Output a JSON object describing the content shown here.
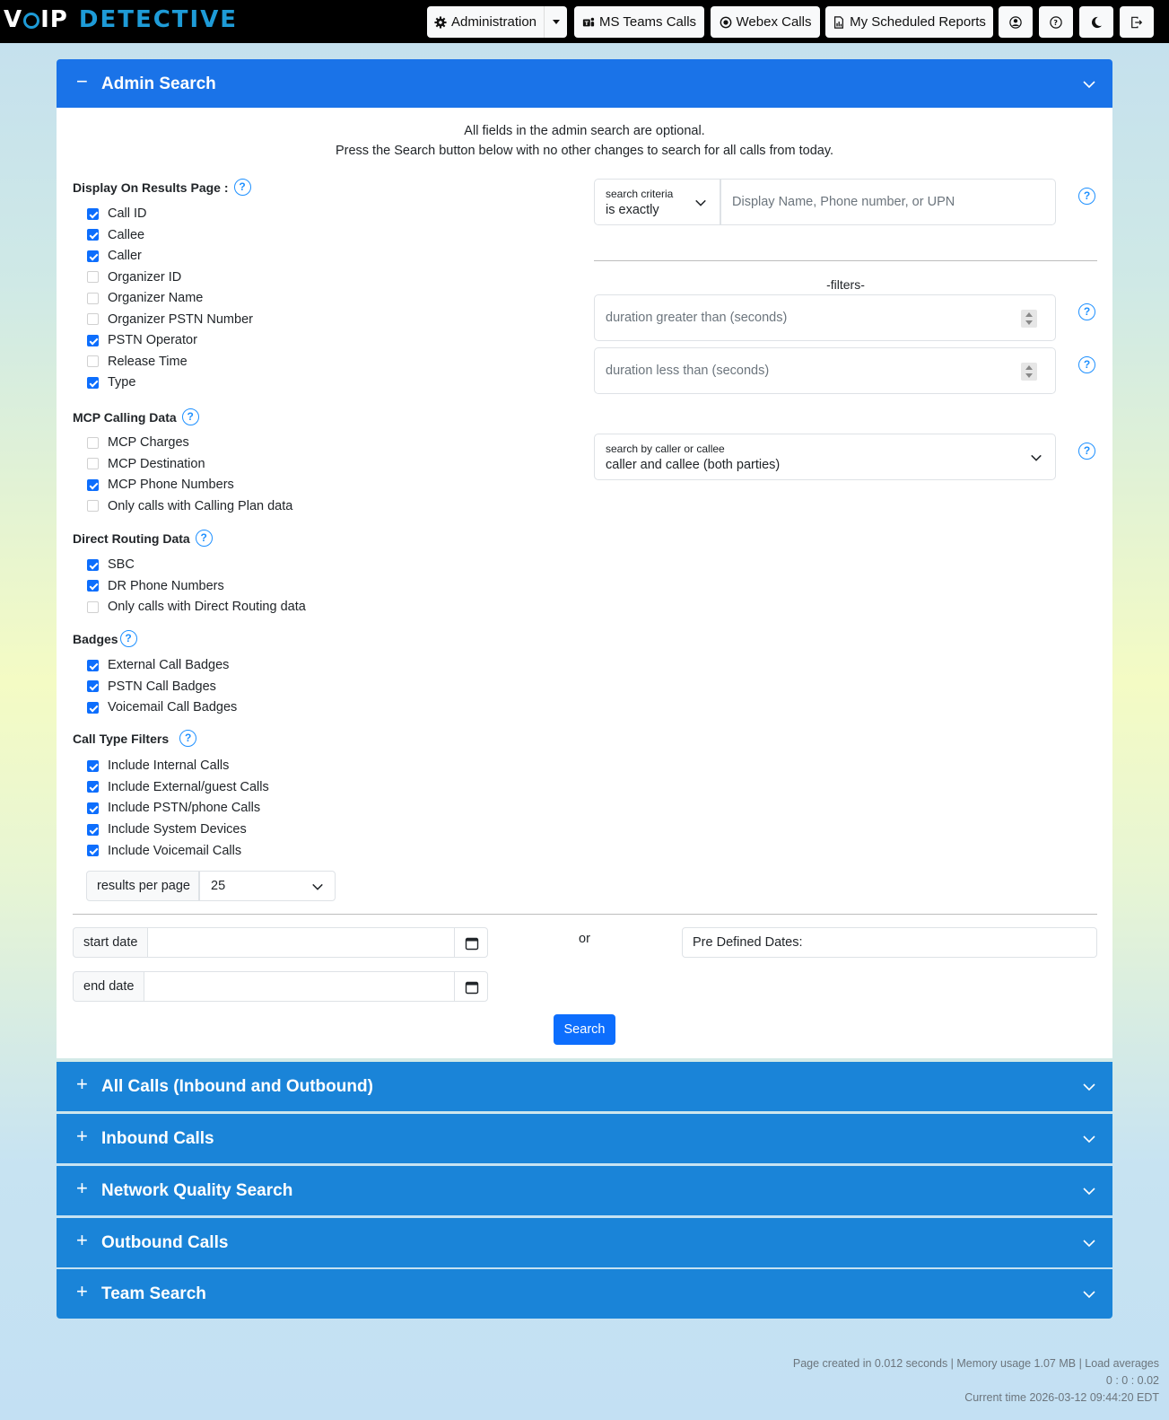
{
  "app": {
    "logo_left": "V",
    "logo_mid": "IP",
    "logo_right": "DETECTIVE"
  },
  "nav": {
    "administration": "Administration",
    "ms_teams": "MS Teams Calls",
    "webex": "Webex Calls",
    "scheduled": "My Scheduled Reports"
  },
  "admin_search": {
    "title": "Admin Search",
    "sign": "−",
    "intro_line1": "All fields in the admin search are optional.",
    "intro_line2": "Press the Search button below with no other changes to search for all calls from today."
  },
  "display_section": {
    "label": "Display On Results Page :",
    "items": [
      {
        "label": "Call ID",
        "checked": true
      },
      {
        "label": "Callee",
        "checked": true
      },
      {
        "label": "Caller",
        "checked": true
      },
      {
        "label": "Organizer ID",
        "checked": false
      },
      {
        "label": "Organizer Name",
        "checked": false
      },
      {
        "label": "Organizer PSTN Number",
        "checked": false
      },
      {
        "label": "PSTN Operator",
        "checked": true
      },
      {
        "label": "Release Time",
        "checked": false
      },
      {
        "label": "Type",
        "checked": true
      }
    ]
  },
  "mcp_section": {
    "label": "MCP Calling Data",
    "items": [
      {
        "label": "MCP Charges",
        "checked": false
      },
      {
        "label": "MCP Destination",
        "checked": false
      },
      {
        "label": "MCP Phone Numbers",
        "checked": true
      },
      {
        "label": "Only calls with Calling Plan data",
        "checked": false
      }
    ]
  },
  "dr_section": {
    "label": "Direct Routing Data",
    "items": [
      {
        "label": "SBC",
        "checked": true
      },
      {
        "label": "DR Phone Numbers",
        "checked": true
      },
      {
        "label": "Only calls with Direct Routing data",
        "checked": false
      }
    ]
  },
  "badges_section": {
    "label": "Badges",
    "items": [
      {
        "label": "External Call Badges",
        "checked": true
      },
      {
        "label": "PSTN Call Badges",
        "checked": true
      },
      {
        "label": "Voicemail Call Badges",
        "checked": true
      }
    ]
  },
  "calltype_section": {
    "label": "Call Type Filters",
    "items": [
      {
        "label": "Include Internal Calls",
        "checked": true
      },
      {
        "label": "Include External/guest Calls",
        "checked": true
      },
      {
        "label": "Include PSTN/phone Calls",
        "checked": true
      },
      {
        "label": "Include System Devices",
        "checked": true
      },
      {
        "label": "Include Voicemail Calls",
        "checked": true
      }
    ]
  },
  "results_per_page": {
    "label": "results per page",
    "value": "25"
  },
  "search_criteria": {
    "label": "search criteria",
    "value": "is exactly",
    "input_placeholder": "Display Name, Phone number, or UPN"
  },
  "filters": {
    "heading": "-filters-",
    "duration_gt": "duration greater than (seconds)",
    "duration_lt": "duration less than (seconds)"
  },
  "caller_callee": {
    "label": "search by caller or callee",
    "value": "caller and callee (both parties)"
  },
  "dates": {
    "start_label": "start date",
    "end_label": "end date",
    "or": "or",
    "predefined": "Pre Defined Dates:"
  },
  "search_button": "Search",
  "accordions": [
    {
      "title": "All Calls (Inbound and Outbound)",
      "sign": "+"
    },
    {
      "title": "Inbound Calls",
      "sign": "+"
    },
    {
      "title": "Network Quality Search",
      "sign": "+"
    },
    {
      "title": "Outbound Calls",
      "sign": "+"
    },
    {
      "title": "Team Search",
      "sign": "+"
    }
  ],
  "footer": {
    "line1": "Page created in 0.012 seconds | Memory usage 1.07 MB | Load averages",
    "line2": "0 : 0 : 0.02",
    "line3": "Current time 2026-03-12 09:44:20 EDT"
  },
  "colors": {
    "header_blue": "#1a73e8",
    "accordion_blue": "#1a84d8",
    "checkbox_blue": "#0d6efd",
    "logo_blue": "#1e9bd7"
  }
}
